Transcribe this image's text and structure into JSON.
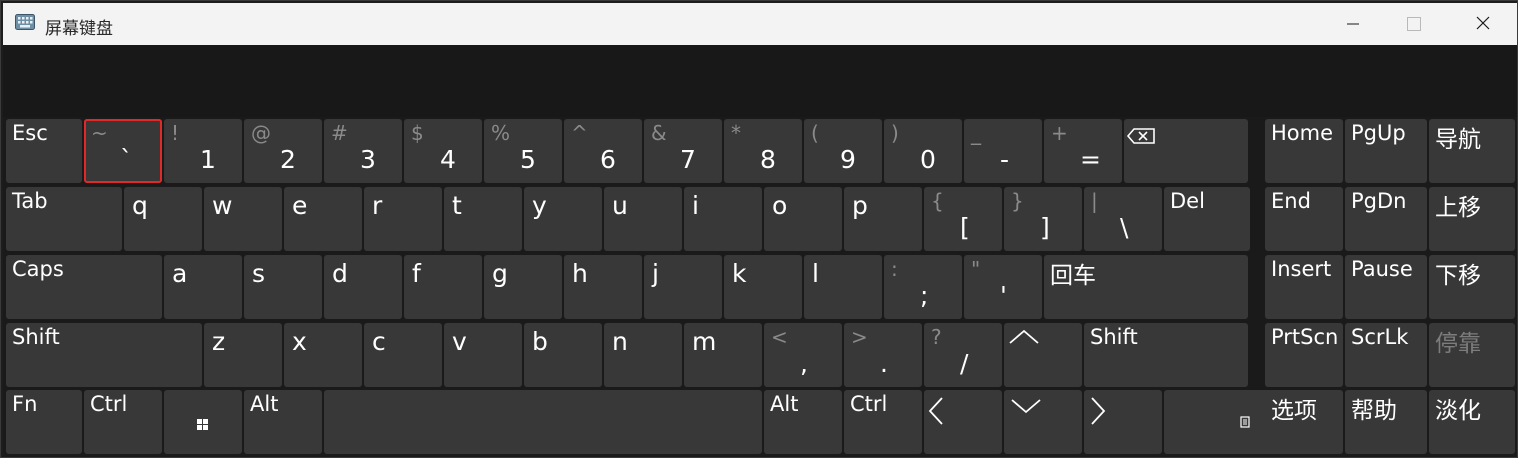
{
  "window": {
    "title": "屏幕键盘",
    "controls": {
      "minimize": "minimize",
      "maximize": "maximize",
      "close": "close"
    }
  },
  "icons": {
    "app": "keyboard-icon",
    "backspace": "backspace-icon",
    "windows": "windows-logo-icon",
    "arrows": [
      "up-arrow-icon",
      "left-arrow-icon",
      "down-arrow-icon",
      "right-arrow-icon"
    ],
    "menu": "context-menu-icon"
  },
  "colors": {
    "key_background": "#383838",
    "key_text": "#ffffff",
    "shift_symbol_text": "#8a8a8a",
    "disabled_text": "#7d7d7d",
    "selection_outline": "#e02a2a",
    "titlebar": "#f3f3f3"
  },
  "selected_key": "~`",
  "keys": {
    "row1": [
      {
        "label": "Esc"
      },
      {
        "top": "~",
        "bottom": "`"
      },
      {
        "top": "!",
        "bottom": "1"
      },
      {
        "top": "@",
        "bottom": "2"
      },
      {
        "top": "#",
        "bottom": "3"
      },
      {
        "top": "$",
        "bottom": "4"
      },
      {
        "top": "%",
        "bottom": "5"
      },
      {
        "top": "^",
        "bottom": "6"
      },
      {
        "top": "&",
        "bottom": "7"
      },
      {
        "top": "*",
        "bottom": "8"
      },
      {
        "top": "(",
        "bottom": "9"
      },
      {
        "top": ")",
        "bottom": "0"
      },
      {
        "top": "_",
        "bottom": "-"
      },
      {
        "top": "+",
        "bottom": "="
      }
    ],
    "row2": [
      {
        "label": "Tab"
      },
      {
        "letter": "q"
      },
      {
        "letter": "w"
      },
      {
        "letter": "e"
      },
      {
        "letter": "r"
      },
      {
        "letter": "t"
      },
      {
        "letter": "y"
      },
      {
        "letter": "u"
      },
      {
        "letter": "i"
      },
      {
        "letter": "o"
      },
      {
        "letter": "p"
      },
      {
        "top": "{",
        "bottom": "["
      },
      {
        "top": "}",
        "bottom": "]"
      },
      {
        "top": "|",
        "bottom": "\\"
      },
      {
        "label": "Del"
      }
    ],
    "row3": [
      {
        "label": "Caps"
      },
      {
        "letter": "a"
      },
      {
        "letter": "s"
      },
      {
        "letter": "d"
      },
      {
        "letter": "f"
      },
      {
        "letter": "g"
      },
      {
        "letter": "h"
      },
      {
        "letter": "j"
      },
      {
        "letter": "k"
      },
      {
        "letter": "l"
      },
      {
        "top": ":",
        "bottom": ";"
      },
      {
        "top": "\"",
        "bottom": "'"
      },
      {
        "cjk": "回车"
      }
    ],
    "row4": [
      {
        "label": "Shift"
      },
      {
        "letter": "z"
      },
      {
        "letter": "x"
      },
      {
        "letter": "c"
      },
      {
        "letter": "v"
      },
      {
        "letter": "b"
      },
      {
        "letter": "n"
      },
      {
        "letter": "m"
      },
      {
        "top": "<",
        "bottom": ","
      },
      {
        "top": ">",
        "bottom": "."
      },
      {
        "top": "?",
        "bottom": "/"
      },
      {
        "label": "Shift"
      }
    ],
    "row5": [
      {
        "label": "Fn"
      },
      {
        "label": "Ctrl"
      },
      {
        "label": "Alt"
      },
      {
        "label": ""
      },
      {
        "label": "Alt"
      },
      {
        "label": "Ctrl"
      }
    ],
    "nav": [
      {
        "label": "Home"
      },
      {
        "label": "PgUp"
      },
      {
        "cjk": "导航"
      },
      {
        "label": "End"
      },
      {
        "label": "PgDn"
      },
      {
        "cjk": "上移"
      },
      {
        "label": "Insert"
      },
      {
        "label": "Pause"
      },
      {
        "cjk": "下移"
      },
      {
        "label": "PrtScn"
      },
      {
        "label": "ScrLk"
      },
      {
        "cjk": "停靠"
      },
      {
        "cjk": "选项"
      },
      {
        "cjk": "帮助"
      },
      {
        "cjk": "淡化"
      }
    ]
  }
}
